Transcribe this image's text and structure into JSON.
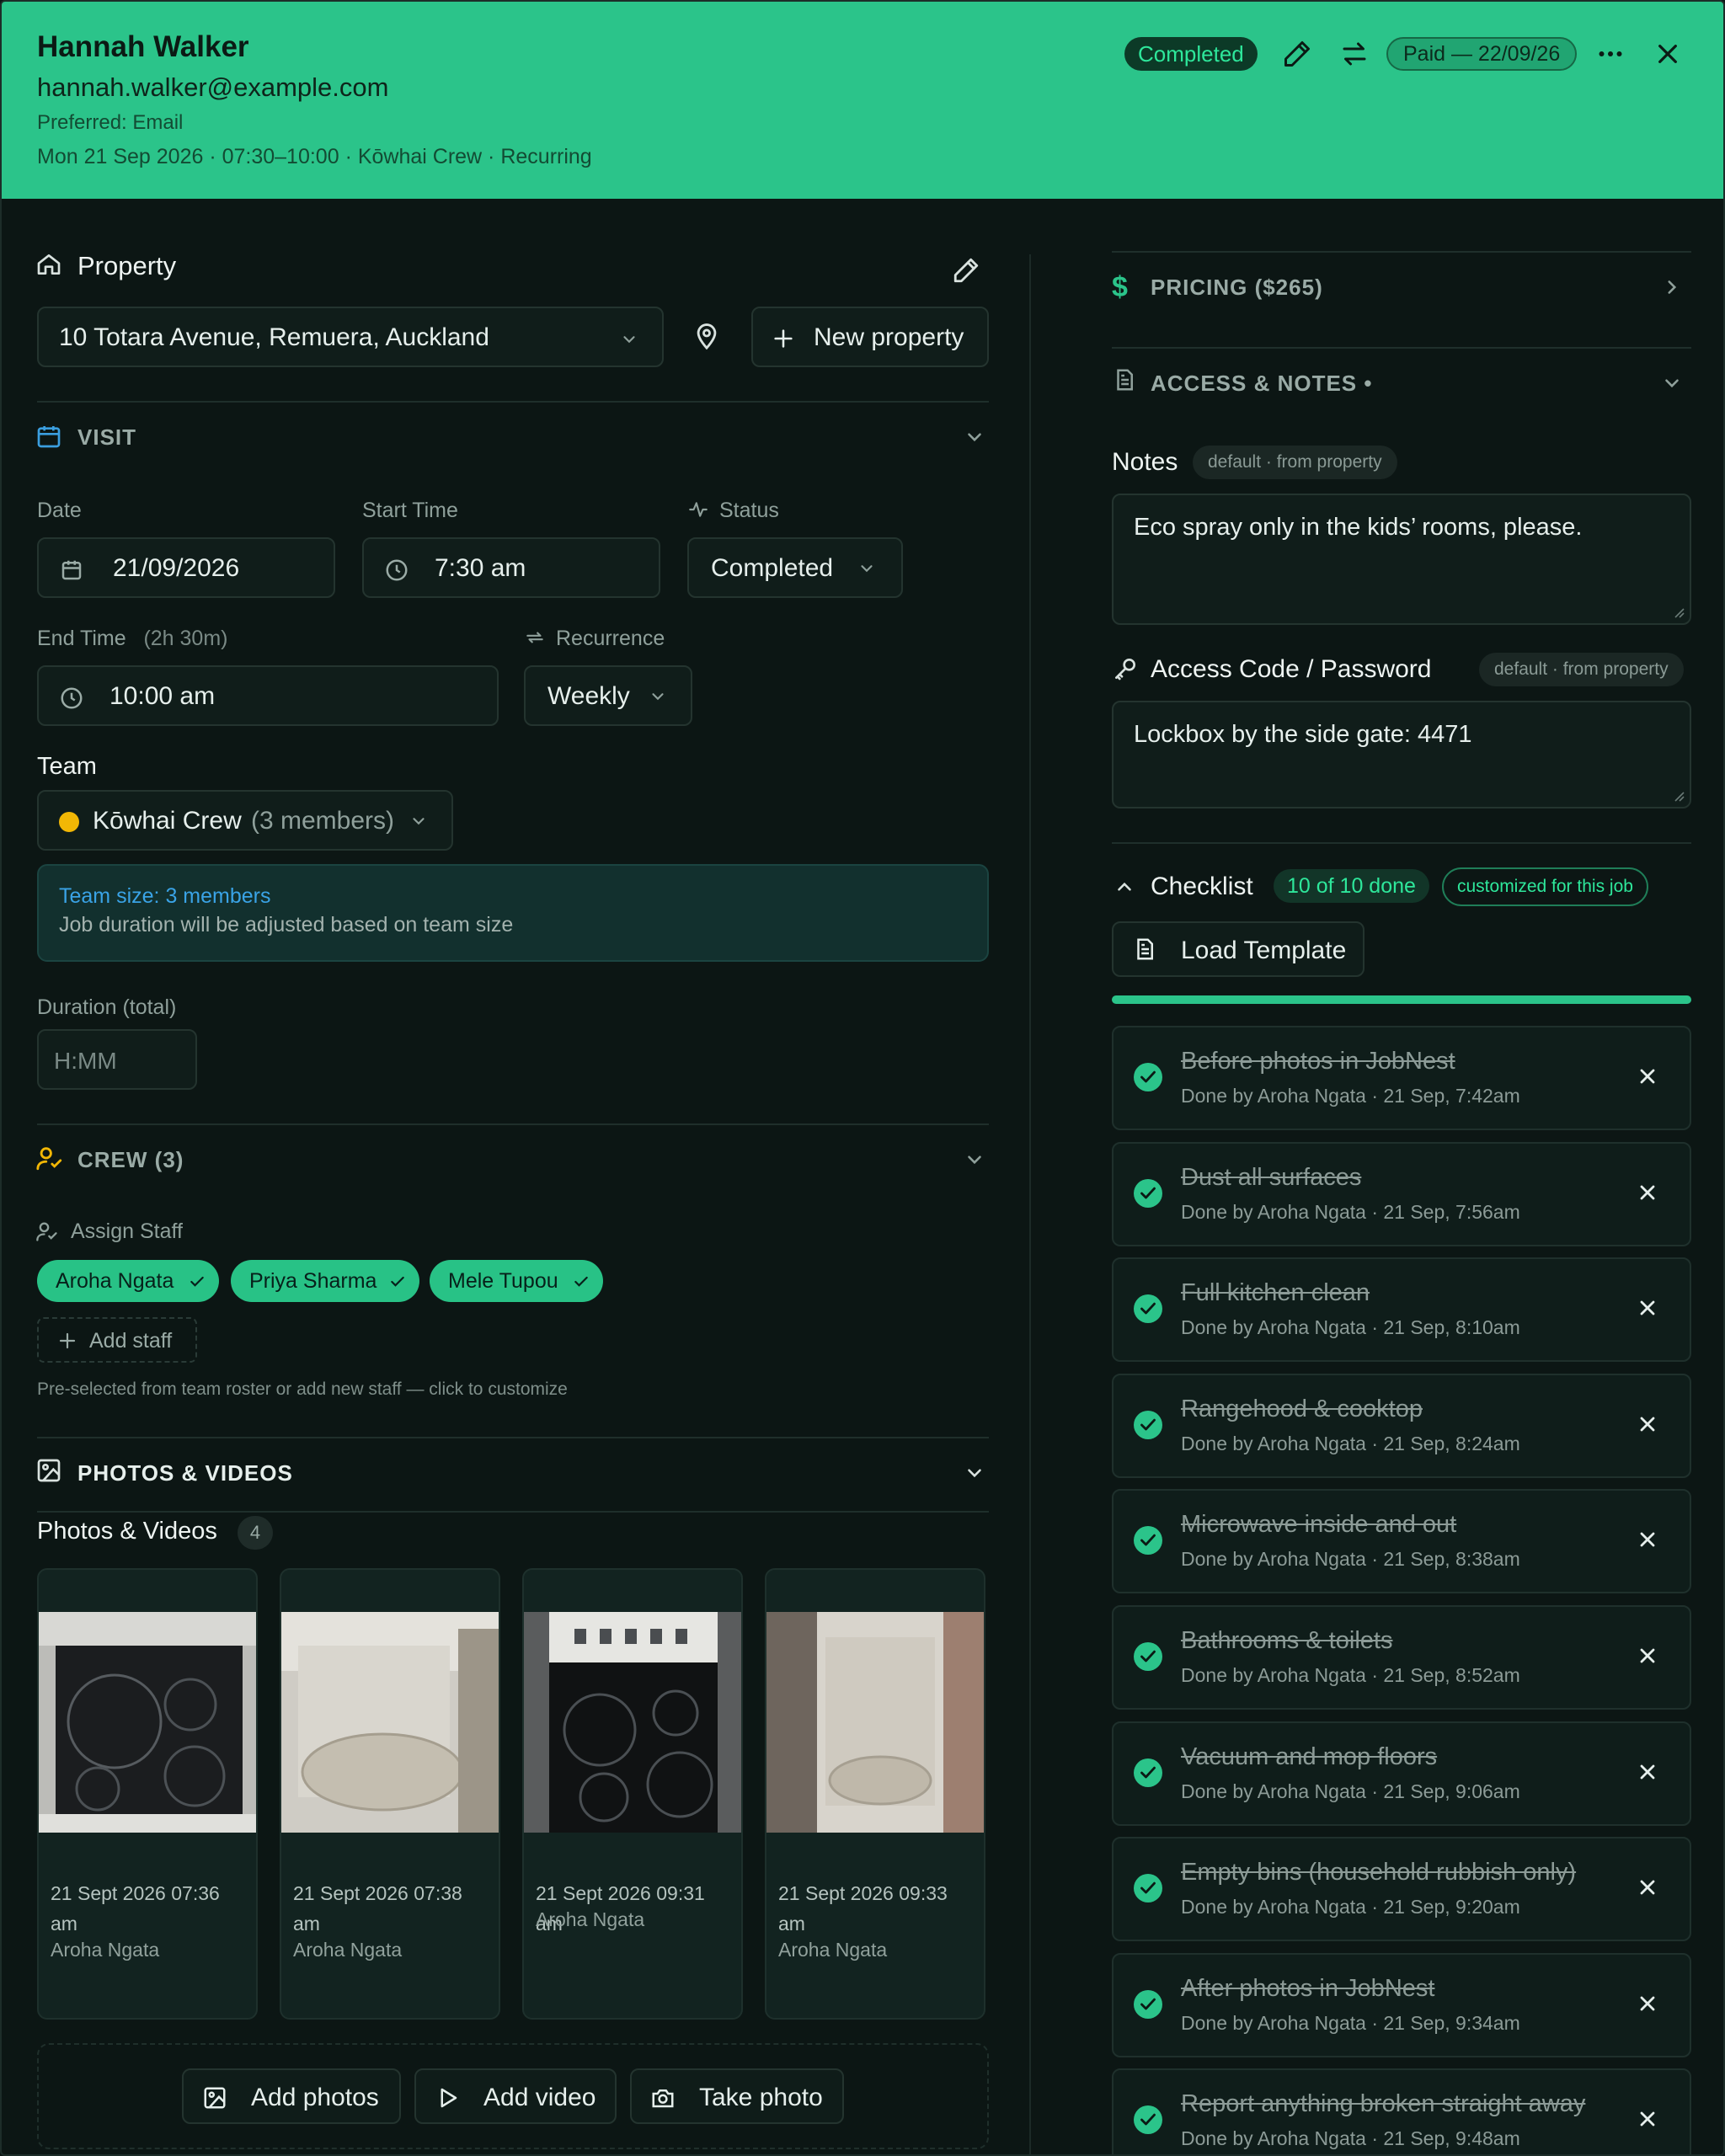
{
  "header": {
    "name": "Hannah Walker",
    "email": "hannah.walker@example.com",
    "preferred": "Preferred: Email",
    "meta": "Mon 21 Sep 2026 · 07:30–10:00 · Kōwhai Crew · Recurring",
    "status_badge": "Completed",
    "paid_badge": "Paid — 22/09/26"
  },
  "property": {
    "title": "Property",
    "address": "10 Totara Avenue, Remuera, Auckland",
    "new_property_label": "New property"
  },
  "visit": {
    "section_title": "VISIT",
    "date_label": "Date",
    "date_value": "21/09/2026",
    "start_label": "Start Time",
    "start_value": "7:30 am",
    "status_label": "Status",
    "status_value": "Completed",
    "end_label": "End Time",
    "end_duration": "(2h 30m)",
    "end_value": "10:00 am",
    "recurrence_label": "Recurrence",
    "recurrence_value": "Weekly",
    "team_label": "Team",
    "team_name": "Kōwhai Crew",
    "team_members": "(3 members)",
    "team_color": "#f2b705",
    "info_prefix": "Team size: ",
    "info_size": "3 members",
    "info_text": "Job duration will be adjusted based on team size",
    "duration_label": "Duration (total)",
    "duration_placeholder": "H:MM"
  },
  "crew": {
    "section_title": "CREW (3)",
    "assign_label": "Assign Staff",
    "staff": [
      "Aroha Ngata",
      "Priya Sharma",
      "Mele Tupou"
    ],
    "add_staff_label": "Add staff",
    "hint": "Pre-selected from team roster or add new staff — click to customize"
  },
  "photos": {
    "section_title": "PHOTOS & VIDEOS",
    "heading": "Photos & Videos",
    "count": "4",
    "items": [
      {
        "date": "21 Sept 2026 07:36 am",
        "by": "Aroha Ngata"
      },
      {
        "date": "21 Sept 2026 07:38 am",
        "by": "Aroha Ngata"
      },
      {
        "date": "21 Sept 2026 09:31 am",
        "by": "Aroha Ngata"
      },
      {
        "date": "21 Sept 2026 09:33 am",
        "by": "Aroha Ngata"
      }
    ],
    "add_photos": "Add photos",
    "add_video": "Add video",
    "take_photo": "Take photo"
  },
  "pricing": {
    "label": "PRICING ($265)"
  },
  "access_notes": {
    "section_title": "ACCESS & NOTES •",
    "notes_label": "Notes",
    "notes_tag": "default · from property",
    "notes_value": "Eco spray only in the kids’ rooms, please.",
    "access_label": "Access Code / Password",
    "access_tag": "default · from property",
    "access_value": "Lockbox by the side gate: 4471"
  },
  "checklist": {
    "title": "Checklist",
    "progress_label": "10 of 10 done",
    "progress": 1.0,
    "custom_tag": "customized for this job",
    "load_template": "Load Template",
    "items": [
      {
        "title": "Before photos in JobNest",
        "sub": "Done by Aroha Ngata · 21 Sep, 7:42am"
      },
      {
        "title": "Dust all surfaces",
        "sub": "Done by Aroha Ngata · 21 Sep, 7:56am"
      },
      {
        "title": "Full kitchen clean",
        "sub": "Done by Aroha Ngata · 21 Sep, 8:10am"
      },
      {
        "title": "Rangehood & cooktop",
        "sub": "Done by Aroha Ngata · 21 Sep, 8:24am"
      },
      {
        "title": "Microwave inside and out",
        "sub": "Done by Aroha Ngata · 21 Sep, 8:38am"
      },
      {
        "title": "Bathrooms & toilets",
        "sub": "Done by Aroha Ngata · 21 Sep, 8:52am"
      },
      {
        "title": "Vacuum and mop floors",
        "sub": "Done by Aroha Ngata · 21 Sep, 9:06am"
      },
      {
        "title": "Empty bins (household rubbish only)",
        "sub": "Done by Aroha Ngata · 21 Sep, 9:20am"
      },
      {
        "title": "After photos in JobNest",
        "sub": "Done by Aroha Ngata · 21 Sep, 9:34am"
      },
      {
        "title": "Report anything broken straight away",
        "sub": "Done by Aroha Ngata · 21 Sep, 9:48am"
      }
    ]
  }
}
